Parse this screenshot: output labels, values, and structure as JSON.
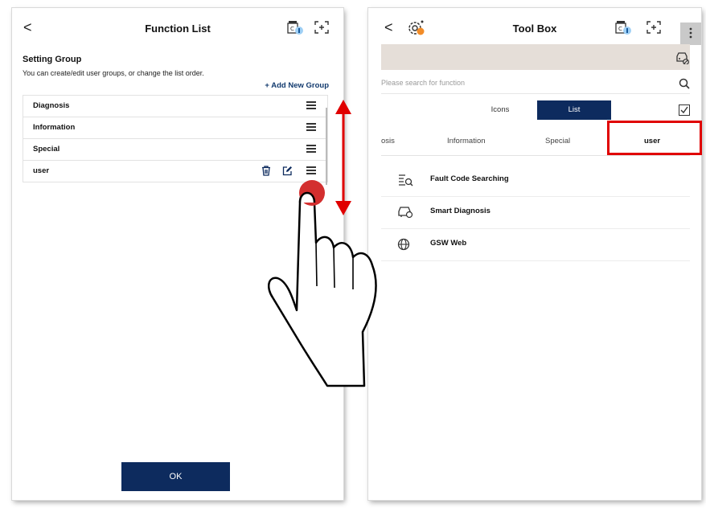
{
  "left_screen": {
    "title": "Function List",
    "back_glyph": "<",
    "icons": [
      "vci-connection-icon",
      "fullscreen-icon"
    ],
    "group_title": "Setting Group",
    "group_desc": "You can create/edit user groups, or change the list order.",
    "add_group_label": "+ Add New Group",
    "groups": [
      {
        "label": "Diagnosis"
      },
      {
        "label": "Information"
      },
      {
        "label": "Special"
      },
      {
        "label": "user"
      }
    ],
    "ok_label": "OK"
  },
  "right_screen": {
    "title": "Tool Box",
    "back_glyph": "<",
    "icons": [
      "tool-settings-icon",
      "vci-connection-icon",
      "fullscreen-icon",
      "more-menu-icon",
      "vehicle-icon"
    ],
    "search_placeholder": "Please search for function",
    "view_toggle": {
      "icons_label": "Icons",
      "list_label": "List",
      "selected": "List"
    },
    "tabs": [
      {
        "label": "osis"
      },
      {
        "label": "Information"
      },
      {
        "label": "Special"
      },
      {
        "label": "user",
        "active": true
      }
    ],
    "functions": [
      {
        "label": "Fault Code Searching",
        "icon": "fault-code-search-icon"
      },
      {
        "label": "Smart Diagnosis",
        "icon": "smart-diagnosis-icon"
      },
      {
        "label": "GSW Web",
        "icon": "globe-icon"
      }
    ]
  },
  "colors": {
    "navy": "#0d2b5e",
    "highlight_red": "#e00000",
    "arrow_red": "#e00000",
    "touch_dot": "#d32f2f",
    "banner": "#e5ded8"
  }
}
